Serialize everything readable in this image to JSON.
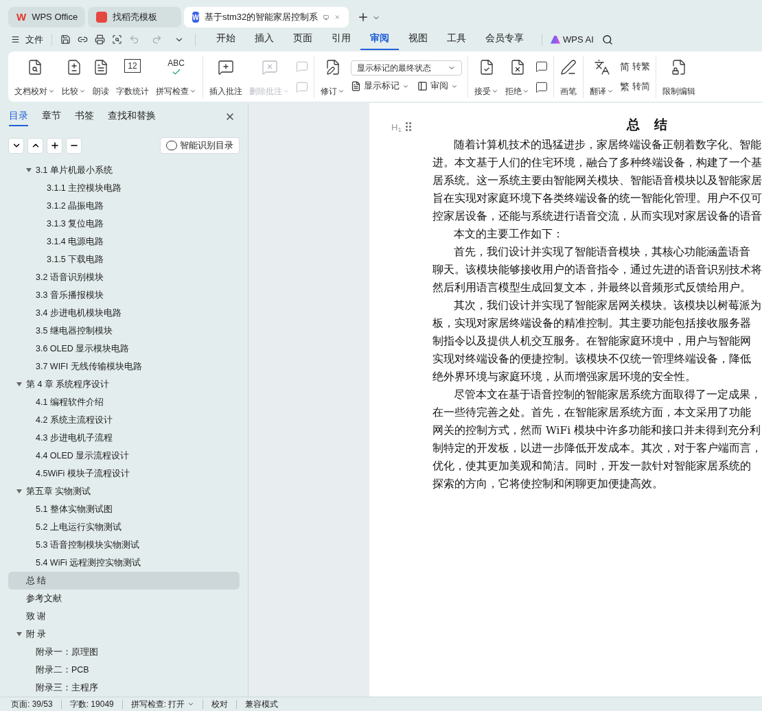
{
  "window_tabs": [
    {
      "label": "WPS Office",
      "selected": false,
      "logo_text": "W"
    },
    {
      "label": "找稻壳模板",
      "selected": false
    },
    {
      "label": "基于stm32的智能家居控制系",
      "selected": true,
      "logo_text": "W"
    }
  ],
  "menu": {
    "file": "文件",
    "tabs": [
      {
        "label": "开始",
        "selected": false
      },
      {
        "label": "插入",
        "selected": false
      },
      {
        "label": "页面",
        "selected": false
      },
      {
        "label": "引用",
        "selected": false
      },
      {
        "label": "审阅",
        "selected": true
      },
      {
        "label": "视图",
        "selected": false
      },
      {
        "label": "工具",
        "selected": false
      },
      {
        "label": "会员专享",
        "selected": false
      }
    ],
    "ai": "WPS AI"
  },
  "ribbon": [
    {
      "items": [
        {
          "kind": "large",
          "label": "文档校对",
          "caret": true,
          "disabled": false
        },
        {
          "kind": "large",
          "label": "比较",
          "caret": true,
          "disabled": false
        },
        {
          "kind": "large",
          "label": "朗读",
          "caret": false,
          "disabled": false
        },
        {
          "kind": "large",
          "label": "字数统计",
          "caret": false,
          "disabled": false,
          "icon_text": "12"
        },
        {
          "kind": "large",
          "label": "拼写检查",
          "caret": true,
          "disabled": false,
          "icon_text": "ABC"
        }
      ]
    },
    {
      "items": [
        {
          "kind": "large",
          "label": "插入批注",
          "caret": false,
          "disabled": false
        },
        {
          "kind": "large",
          "label": "删除批注",
          "caret": true,
          "disabled": true
        },
        {
          "kind": "stack",
          "disabled": true
        }
      ]
    },
    {
      "items": [
        {
          "kind": "large",
          "label": "修订",
          "caret": true,
          "disabled": false
        },
        {
          "kind": "markup",
          "select": "显示标记的最终状态",
          "show": "显示标记",
          "review": "审阅"
        }
      ]
    },
    {
      "items": [
        {
          "kind": "large",
          "label": "接受",
          "caret": true,
          "disabled": false
        },
        {
          "kind": "large",
          "label": "拒绝",
          "caret": true,
          "disabled": false
        },
        {
          "kind": "stack",
          "disabled": false
        }
      ]
    },
    {
      "items": [
        {
          "kind": "large",
          "label": "画笔",
          "caret": false,
          "disabled": false
        }
      ]
    },
    {
      "items": [
        {
          "kind": "large",
          "label": "翻译",
          "caret": true,
          "disabled": false
        },
        {
          "kind": "convert",
          "top_icon": "简",
          "top": "转繁",
          "bottom_icon": "繁",
          "bottom": "转简"
        }
      ]
    },
    {
      "items": [
        {
          "kind": "large",
          "label": "限制编辑",
          "caret": false,
          "disabled": false
        }
      ]
    }
  ],
  "nav_panel": {
    "tabs": [
      {
        "label": "目录",
        "selected": true
      },
      {
        "label": "章节",
        "selected": false
      },
      {
        "label": "书签",
        "selected": false
      },
      {
        "label": "查找和替换",
        "selected": false
      }
    ],
    "smart_button": "智能识别目录",
    "toc_continued": [
      {
        "label": "3.1 单片机最小系统",
        "selected": false,
        "expanded": true,
        "children": [
          {
            "label": "3.1.1  主控模块电路",
            "selected": false
          },
          {
            "label": "3.1.2  晶振电路",
            "selected": false
          },
          {
            "label": "3.1.3  复位电路",
            "selected": false
          },
          {
            "label": "3.1.4  电源电路",
            "selected": false
          },
          {
            "label": "3.1.5  下载电路",
            "selected": false
          }
        ]
      },
      {
        "label": "3.2 语音识别模块",
        "selected": false
      },
      {
        "label": "3.3 音乐播报模块",
        "selected": false
      },
      {
        "label": "3.4 步进电机模块电路",
        "selected": false
      },
      {
        "label": "3.5 继电器控制模块",
        "selected": false
      },
      {
        "label": "3.6 OLED 显示模块电路",
        "selected": false
      },
      {
        "label": "3.7 WIFI 无线传输模块电路",
        "selected": false
      }
    ],
    "toc": [
      {
        "label": "第 4 章  系统程序设计",
        "selected": false,
        "expanded": true,
        "children": [
          {
            "label": "4.1  编程软件介绍",
            "selected": false
          },
          {
            "label": "4.2  系统主流程设计",
            "selected": false
          },
          {
            "label": "4.3 步进电机子流程",
            "selected": false
          },
          {
            "label": "4.4 OLED 显示流程设计",
            "selected": false
          },
          {
            "label": "4.5WiFi 模块子流程设计",
            "selected": false
          }
        ]
      },
      {
        "label": "第五章  实物测试",
        "selected": false,
        "expanded": true,
        "children": [
          {
            "label": "5.1  整体实物测试图",
            "selected": false
          },
          {
            "label": "5.2  上电运行实物测试",
            "selected": false
          },
          {
            "label": "5.3  语音控制模块实物测试",
            "selected": false
          },
          {
            "label": "5.4 WiFi 远程测控实物测试",
            "selected": false
          }
        ]
      },
      {
        "label": "总    结",
        "selected": true
      },
      {
        "label": "参考文献",
        "selected": false
      },
      {
        "label": "致    谢",
        "selected": false
      },
      {
        "label": "附    录",
        "selected": false,
        "expanded": true,
        "children": [
          {
            "label": "附录一：原理图",
            "selected": false
          },
          {
            "label": "附录二：PCB",
            "selected": false
          },
          {
            "label": "附录三：主程序",
            "selected": false
          }
        ]
      }
    ]
  },
  "document": {
    "heading_marker": "H$_{1}$",
    "title": "总    结",
    "lines": [
      {
        "text": "随着计算机技术的迅猛进步，家居终端设备正朝着数字化、智能",
        "indent": true
      },
      {
        "text": "进。本文基于人们的住宅环境，融合了多种终端设备，构建了一个基",
        "indent": false
      },
      {
        "text": "居系统。这一系统主要由智能网关模块、智能语音模块以及智能家居",
        "indent": false
      },
      {
        "text": "旨在实现对家庭环境下各类终端设备的统一智能化管理。用户不仅可",
        "indent": false
      },
      {
        "text": "控家居设备，还能与系统进行语音交流，从而实现对家居设备的语音",
        "indent": false
      },
      {
        "text": "本文的主要工作如下：",
        "indent": true
      },
      {
        "text": "首先，我们设计并实现了智能语音模块，其核心功能涵盖语音",
        "indent": true
      },
      {
        "text": "聊天。该模块能够接收用户的语音指令，通过先进的语音识别技术将",
        "indent": false
      },
      {
        "text": "然后利用语言模型生成回复文本，并最终以音频形式反馈给用户。",
        "indent": false
      },
      {
        "text": "其次，我们设计并实现了智能家居网关模块。该模块以树莓派为",
        "indent": true
      },
      {
        "text": "板，实现对家居终端设备的精准控制。其主要功能包括接收服务器",
        "indent": false
      },
      {
        "text": "制指令以及提供人机交互服务。在智能家庭环境中，用户与智能网",
        "indent": false
      },
      {
        "text": "实现对终端设备的便捷控制。该模块不仅统一管理终端设备，降低",
        "indent": false
      },
      {
        "text": "绝外界环境与家庭环境，从而增强家居环境的安全性。",
        "indent": false
      },
      {
        "text": "尽管本文在基于语音控制的智能家居系统方面取得了一定成果，",
        "indent": true
      },
      {
        "text": "在一些待完善之处。首先，在智能家居系统方面，本文采用了功能",
        "indent": false
      },
      {
        "text": "网关的控制方式，然而 WiFi 模块中许多功能和接口并未得到充分利",
        "indent": false
      },
      {
        "text": "制特定的开发板，以进一步降低开发成本。其次，对于客户端而言，",
        "indent": false
      },
      {
        "text": "优化，使其更加美观和简洁。同时，开发一款针对智能家居系统的",
        "indent": false
      },
      {
        "text": "探索的方向，它将使控制和闲聊更加便捷高效。",
        "indent": false
      }
    ]
  },
  "status_bar": {
    "page": "页面: 39/53",
    "words": "字数: 19049",
    "spell": "拼写检查: 打开",
    "proof": "校对",
    "mode": "兼容模式"
  }
}
